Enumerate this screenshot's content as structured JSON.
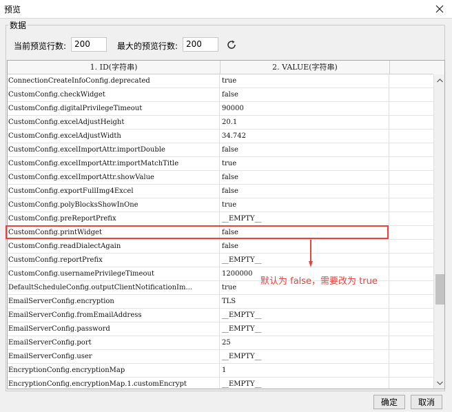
{
  "window": {
    "title": "预览"
  },
  "group": {
    "label": "数据"
  },
  "controls": {
    "current_rows_label": "当前预览行数:",
    "current_rows_value": "200",
    "max_rows_label": "最大的预览行数:",
    "max_rows_value": "200"
  },
  "table": {
    "columns": [
      "1. ID(字符串)",
      "2. VALUE(字符串)"
    ],
    "rows": [
      [
        "ConnectionCreateInfoConfig.deprecated",
        "true"
      ],
      [
        "CustomConfig.checkWidget",
        "false"
      ],
      [
        "CustomConfig.digitalPrivilegeTimeout",
        "90000"
      ],
      [
        "CustomConfig.excelAdjustHeight",
        "20.1"
      ],
      [
        "CustomConfig.excelAdjustWidth",
        "34.742"
      ],
      [
        "CustomConfig.excelImportAttr.importDouble",
        "false"
      ],
      [
        "CustomConfig.excelImportAttr.importMatchTitle",
        "true"
      ],
      [
        "CustomConfig.excelImportAttr.showValue",
        "false"
      ],
      [
        "CustomConfig.exportFullImg4Excel",
        "false"
      ],
      [
        "CustomConfig.polyBlocksShowInOne",
        "true"
      ],
      [
        "CustomConfig.preReportPrefix",
        "__EMPTY__"
      ],
      [
        "CustomConfig.printWidget",
        "false"
      ],
      [
        "CustomConfig.readDialectAgain",
        "false"
      ],
      [
        "CustomConfig.reportPrefix",
        "__EMPTY__"
      ],
      [
        "CustomConfig.usernamePrivilegeTimeout",
        "1200000"
      ],
      [
        "DefaultScheduleConfig.outputClientNotificationIm...",
        "true"
      ],
      [
        "EmailServerConfig.encryption",
        "TLS"
      ],
      [
        "EmailServerConfig.fromEmailAddress",
        "__EMPTY__"
      ],
      [
        "EmailServerConfig.password",
        "__EMPTY__"
      ],
      [
        "EmailServerConfig.port",
        "25"
      ],
      [
        "EmailServerConfig.user",
        "__EMPTY__"
      ],
      [
        "EncryptionConfig.encryptionMap",
        "1"
      ],
      [
        "EncryptionConfig.encryptionMap.1.customEncrypt",
        "__EMPTY__"
      ]
    ]
  },
  "annotation": {
    "text": "默认为 false，需要改为 true",
    "color": "#e8423a"
  },
  "buttons": {
    "ok": "确定",
    "cancel": "取消"
  }
}
